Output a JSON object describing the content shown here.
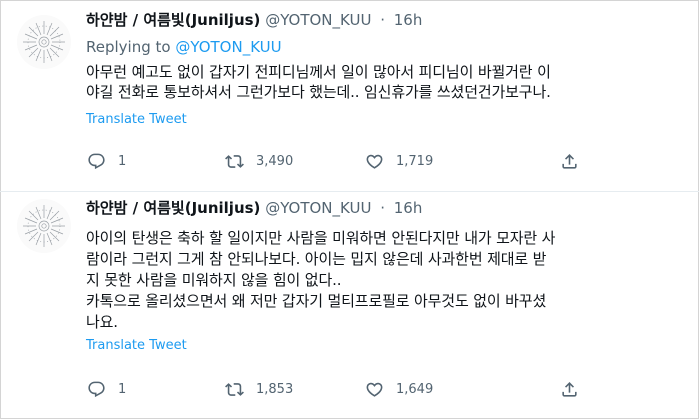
{
  "tweets": [
    {
      "display_name": "하얀밤 / 여름빛(Juniljus)",
      "handle": "@YOTON_KUU",
      "separator": "·",
      "time": "16h",
      "replying_to_label": "Replying to",
      "replying_to_mention": "@YOTON_KUU",
      "text": "아무런 예고도 없이 갑자기 전피디님께서 일이 많아서 피디님이 바뀔거란 이\n야길 전화로 통보하셔서 그런가보다 했는데.. 임신휴가를 쓰셨던건가보구나.",
      "translate_label": "Translate Tweet",
      "replies": "1",
      "retweets": "3,490",
      "likes": "1,719"
    },
    {
      "display_name": "하얀밤 / 여름빛(Juniljus)",
      "handle": "@YOTON_KUU",
      "separator": "·",
      "time": "16h",
      "text": "아이의 탄생은 축하 할 일이지만 사람을 미워하면 안된다지만 내가 모자란 사\n람이라 그런지 그게 참 안되나보다. 아이는 밉지 않은데 사과한번 제대로 받\n지 못한 사람을 미워하지 않을 힘이 없다..\n카톡으로 올리셨으면서 왜 저만 갑자기 멀티프로필로 아무것도 없이 바꾸셨\n나요.",
      "translate_label": "Translate Tweet",
      "replies": "1",
      "retweets": "1,853",
      "likes": "1,649"
    }
  ],
  "icons": {
    "avatar": "sun-emblem-icon",
    "reply": "reply-bubble-icon",
    "retweet": "retweet-icon",
    "like": "heart-icon",
    "share": "share-icon"
  },
  "colors": {
    "link": "#1d9bf0",
    "muted": "#536471",
    "text": "#0f1419"
  }
}
